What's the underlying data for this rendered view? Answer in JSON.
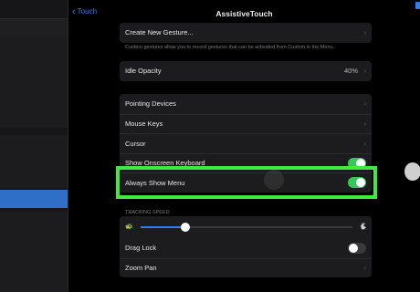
{
  "header": {
    "back_label": "Touch",
    "title": "AssistiveTouch"
  },
  "gesture": {
    "create_label": "Create New Gesture...",
    "caption": "Custom gestures allow you to record gestures that can be activated from Custom in the Menu."
  },
  "idle": {
    "label": "Idle Opacity",
    "value": "40%"
  },
  "devices": {
    "items": [
      {
        "label": "Pointing Devices"
      },
      {
        "label": "Mouse Keys"
      },
      {
        "label": "Cursor"
      },
      {
        "label": "Show Onscreen Keyboard",
        "toggle": true
      },
      {
        "label": "Always Show Menu",
        "toggle": true
      }
    ]
  },
  "tracking": {
    "caption": "TRACKING SPEED",
    "value_fraction": 0.21
  },
  "more": {
    "drag_lock": {
      "label": "Drag Lock",
      "toggle": false
    },
    "zoom_pan": {
      "label": "Zoom Pan"
    }
  },
  "colors": {
    "accent": "#2f7df6",
    "toggle_on": "#34c759",
    "highlight": "#3dea3d"
  },
  "icons": [
    "chevron-left-icon",
    "chevron-right-icon",
    "tortoise-icon",
    "hare-icon",
    "assistive-touch-button-icon"
  ]
}
